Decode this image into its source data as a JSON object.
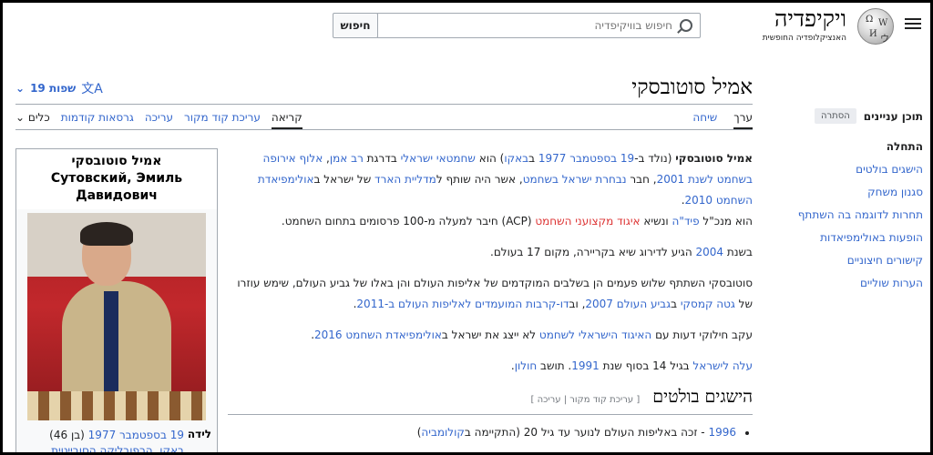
{
  "header": {
    "logo_name": "ויקיפדיה",
    "logo_tagline": "האנציקלופדיה החופשית",
    "search_placeholder": "חיפוש בוויקיפדיה",
    "search_button": "חיפוש"
  },
  "article": {
    "title": "אמיל סוטובסקי",
    "languages_label": "19 שפות"
  },
  "tabs": {
    "right": [
      {
        "label": "ערך",
        "active": true
      },
      {
        "label": "שיחה",
        "active": false
      }
    ],
    "left": [
      {
        "label": "קריאה",
        "active": true
      },
      {
        "label": "עריכת קוד מקור",
        "active": false
      },
      {
        "label": "עריכה",
        "active": false
      },
      {
        "label": "גרסאות קודמות",
        "active": false
      },
      {
        "label": "כלים",
        "active": false
      }
    ]
  },
  "toc": {
    "title": "תוכן עניינים",
    "hide_label": "הסתרה",
    "items": [
      "התחלה",
      "הישגים בולטים",
      "סגנון משחק",
      "תחרות לדוגמה בה השתתף",
      "הופעות באולימפיאדות",
      "קישורים חיצוניים",
      "הערות שוליים"
    ]
  },
  "infobox": {
    "title": "אמיל סוטובסקי\nСутовский, Эмиль Давидович",
    "birth_label": "לידה",
    "birth_value_link": "19 בספטמבר 1977",
    "birth_value_text": " (בן 46)",
    "birth_place_link": "באקו, הרפובליקה הסובייטית הסוציאליסטית של אזרבייג'ן"
  },
  "content": {
    "p1": {
      "bold": "אמיל סוטובסקי",
      "t1": " (נולד ב-",
      "l1": "19 בספטמבר",
      "t2": " ",
      "l2": "1977",
      "t3": " ב",
      "l3": "באקו",
      "t4": ") הוא ",
      "l4": "שחמטאי",
      "t5": " ",
      "l5": "ישראלי",
      "t6": " בדרגת ",
      "l6": "רב אמן",
      "t7": ", ",
      "l7": "אלוף אירופה בשחמט לשנת 2001",
      "t8": ", חבר ",
      "l8": "נבחרת ישראל בשחמט",
      "t9": ", אשר היה שותף ל",
      "l9": "מדליית הארד",
      "t10": " של ישראל ב",
      "l10": "אולימפיאדת השחמט 2010",
      "t11": "."
    },
    "p2": {
      "t1": "הוא מנכ\"ל ",
      "l1": "פיד\"ה",
      "t2": " ונשיא ",
      "r1": "איגוד מקצועני השחמט",
      "t3": " (ACP) חיבר למעלה מ-100 פרסומים בתחום השחמט."
    },
    "p3": {
      "t1": "בשנת ",
      "l1": "2004",
      "t2": " הגיע לדירוג שיא בקריירה, מקום 17 בעולם."
    },
    "p4": {
      "t1": "סוטובסקי השתתף שלוש פעמים הן בשלבים המוקדמים של אליפות העולם והן באלו של גביע העולם, שימש עוזרו של ",
      "l1": "גטה קמסקי",
      "t2": " ב",
      "l2": "גביע העולם 2007",
      "t3": ", וב",
      "l3": "דו-קרבות המועמדים לאליפות העולם ב-2011",
      "t4": "."
    },
    "p5": {
      "t1": "עקב חילוקי דעות עם ",
      "l1": "האיגוד הישראלי לשחמט",
      "t2": " לא ייצג את ישראל ב",
      "l2": "אולימפיאדת השחמט 2016",
      "t3": "."
    },
    "p6": {
      "l1": "עלה לישראל",
      "t1": " בגיל 14 בסוף שנת ",
      "l2": "1991",
      "t2": ". תושב ",
      "l3": "חולון",
      "t3": "."
    },
    "section_title": "הישגים בולטים",
    "section_edit": "[ עריכת קוד מקור | עריכה ]",
    "list": [
      {
        "l1": "1996",
        "t1": " - זכה באליפות העולם לנוער עד גיל 20 (התקיימה ב",
        "l2": "קולומביה",
        "t2": ")"
      }
    ]
  },
  "colors": {
    "link": "#3366cc",
    "redlink": "#dd3333",
    "text": "#202122"
  }
}
